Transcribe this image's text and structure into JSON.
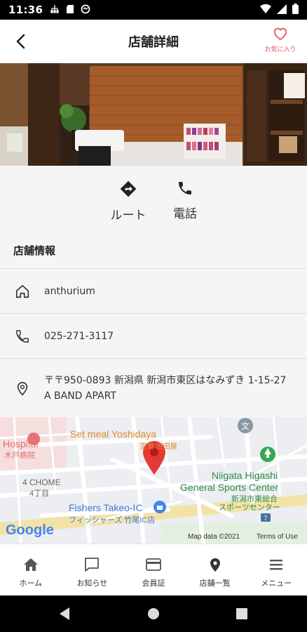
{
  "status_bar": {
    "time": "11:36",
    "left_icons": [
      "ethernet-icon",
      "sd-card-icon",
      "sync-icon"
    ],
    "right_icons": [
      "wifi-icon",
      "signal-icon",
      "battery-icon"
    ]
  },
  "header": {
    "title": "店舗詳細",
    "favorite_label": "お気に入り"
  },
  "actions": {
    "route_label": "ルート",
    "phone_label": "電話"
  },
  "store_info": {
    "section_title": "店舗情報",
    "name": "anthurium",
    "phone": "025-271-3117",
    "address_line1": "〒〒950-0893 新潟県 新潟市東区はなみずき 1-15-27",
    "address_line2": "A BAND APART"
  },
  "map": {
    "labels": {
      "hospital": "Hospital",
      "hospital_jp": "木戸病院",
      "set_meal": "Set meal Yoshidaya",
      "set_meal_jp": "定食 吉田屋",
      "chome": "4 CHOME",
      "chome_jp": "4丁目",
      "sports_en1": "Niigata Higashi",
      "sports_en2": "General Sports Center",
      "sports_jp1": "新潟市東総合",
      "sports_jp2": "スポーツセンター",
      "fishers": "Fishers Takeo-IC",
      "fishers_jp": "フィッシャーズ 竹尾IC店",
      "google": "Google",
      "map_data": "Map data ©2021",
      "terms": "Terms of Use",
      "road_number": "7"
    },
    "colors": {
      "pin": "#e53935",
      "park": "#34a853",
      "road": "#ffffff",
      "highway": "#f5d77a"
    }
  },
  "bottom_nav": {
    "items": [
      {
        "label": "ホーム",
        "icon": "home-icon"
      },
      {
        "label": "お知らせ",
        "icon": "message-icon"
      },
      {
        "label": "会員証",
        "icon": "card-icon"
      },
      {
        "label": "店舗一覧",
        "icon": "location-icon"
      },
      {
        "label": "メニュー",
        "icon": "menu-icon"
      }
    ]
  },
  "colors": {
    "accent": "#e25563",
    "text": "#333333",
    "background": "#f5f5f5"
  }
}
